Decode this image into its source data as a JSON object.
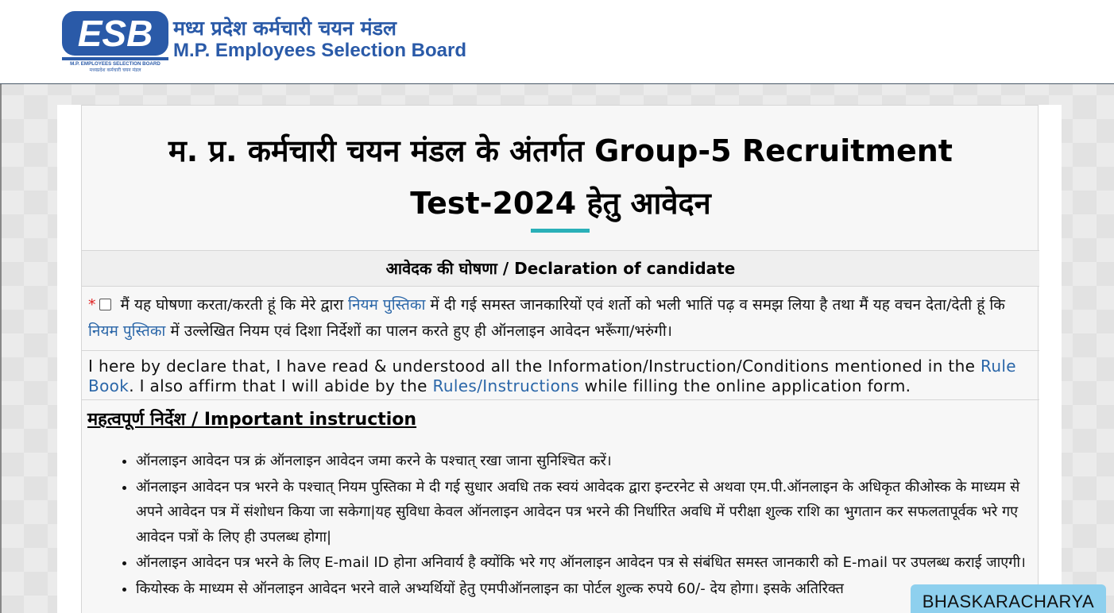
{
  "header": {
    "logo_text": "ESB",
    "logo_tagline_en": "M.P. EMPLOYEES SELECTION BOARD",
    "logo_tagline_hi": "मध्यप्रदेश कर्मचारी चयन मंडल",
    "org_name_hi": "मध्य प्रदेश कर्मचारी चयन मंडल",
    "org_name_en": "M.P. Employees Selection Board"
  },
  "page": {
    "title_line1": "म. प्र. कर्मचारी चयन मंडल के अंतर्गत Group-5 Recruitment",
    "title_line2": "Test-2024 हेतु आवेदन"
  },
  "declaration": {
    "heading": "आवेदक की घोषणा / Declaration of candidate",
    "required_mark": "*",
    "checkbox_checked": false,
    "hi_part1": "मैं यह घोषणा करता/करती हूं कि मेरे द्वारा ",
    "hi_link1": "नियम पुस्तिका",
    "hi_part2": " में दी गई समस्त जानकारियों एवं शर्तो को भली भातिं पढ़ व समझ लिया है तथा मैं यह वचन देता/देती हूं कि ",
    "hi_link2": "नियम पुस्तिका",
    "hi_part3": " में उल्लेखित नियम एवं दिशा निर्देशों का पालन करते हुए ही ऑनलाइन आवेदन भरूँगा/भरुंगी।",
    "en_part1": "I here by declare that, I have read & understood all the Information/Instruction/Conditions mentioned in the ",
    "en_link1": "Rule Book",
    "en_part2": ". I also affirm that I will abide by the ",
    "en_link2": "Rules/Instructions",
    "en_part3": " while filling the online application form."
  },
  "instructions": {
    "heading": "महत्वपूर्ण निर्देश / Important instruction",
    "items": [
      "ऑनलाइन आवेदन पत्र क्रं ऑनलाइन आवेदन जमा करने के पश्चात् रखा जाना सुनिश्चित करें।",
      "ऑनलाइन आवेदन पत्र भरने के पश्चात् नियम पुस्तिका मे दी गई सुधार अवधि तक स्वयं आवेदक द्वारा इन्टरनेट से अथवा एम.पी.ऑनलाइन के अधिकृत कीओस्क के माध्यम से अपने आवेदन पत्र में संशोधन किया जा सकेगा|यह सुविधा केवल ऑनलाइन आवेदन पत्र भरने की निर्धारित अवधि में परीक्षा शुल्क राशि का भुगतान कर सफलतापूर्वक भरे गए आवेदन पत्रों के लिए ही उपलब्ध होगा|",
      "ऑनलाइन आवेदन पत्र भरने के लिए E-mail ID होना अनिवार्य है क्योंकि भरे गए ऑनलाइन आवेदन पत्र से संबंधित समस्त जानकारी को E-mail पर उपलब्ध कराई जाएगी।",
      "कियोस्क के माध्यम से ऑनलाइन आवेदन भरने वाले अभ्यर्थियों हेतु एमपीऑनलाइन का पोर्टल शुल्क रुपये 60/- देय होगा। इसके अतिरिक्त"
    ]
  },
  "badge": {
    "label": "BHASKARACHARYA"
  },
  "colors": {
    "brand_blue": "#2a5aa8",
    "link": "#2a66a8",
    "accent_rule": "#2ab0b8",
    "badge_bg": "#8ed0ee",
    "required": "#e02020"
  }
}
